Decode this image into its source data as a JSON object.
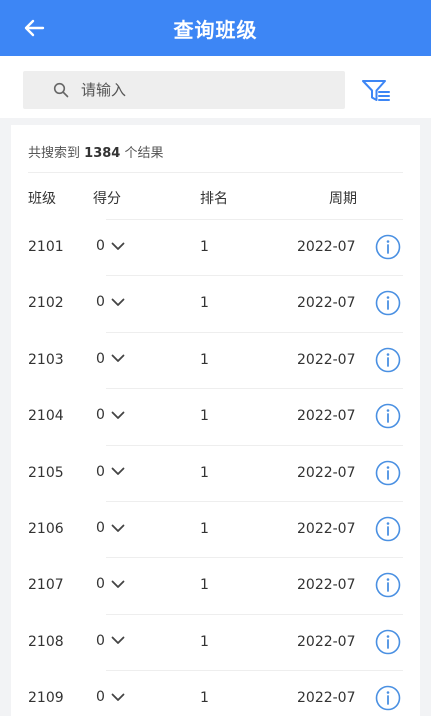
{
  "header": {
    "title": "查询班级",
    "back_icon": "arrow-left-icon",
    "background": "#3d86f5"
  },
  "search": {
    "placeholder": "请输入",
    "value": "",
    "icon": "search-icon",
    "filter_icon": "filter-icon"
  },
  "results": {
    "prefix": "共搜索到",
    "count": "1384",
    "suffix": "个结果"
  },
  "columns": {
    "class": "班级",
    "score": "得分",
    "rank": "排名",
    "period": "周期"
  },
  "rows": [
    {
      "class": "2101",
      "score": "0",
      "rank": "1",
      "period": "2022-07"
    },
    {
      "class": "2102",
      "score": "0",
      "rank": "1",
      "period": "2022-07"
    },
    {
      "class": "2103",
      "score": "0",
      "rank": "1",
      "period": "2022-07"
    },
    {
      "class": "2104",
      "score": "0",
      "rank": "1",
      "period": "2022-07"
    },
    {
      "class": "2105",
      "score": "0",
      "rank": "1",
      "period": "2022-07"
    },
    {
      "class": "2106",
      "score": "0",
      "rank": "1",
      "period": "2022-07"
    },
    {
      "class": "2107",
      "score": "0",
      "rank": "1",
      "period": "2022-07"
    },
    {
      "class": "2108",
      "score": "0",
      "rank": "1",
      "period": "2022-07"
    },
    {
      "class": "2109",
      "score": "0",
      "rank": "1",
      "period": "2022-07"
    }
  ],
  "colors": {
    "accent": "#3d86f5",
    "info": "#4a90e2"
  }
}
